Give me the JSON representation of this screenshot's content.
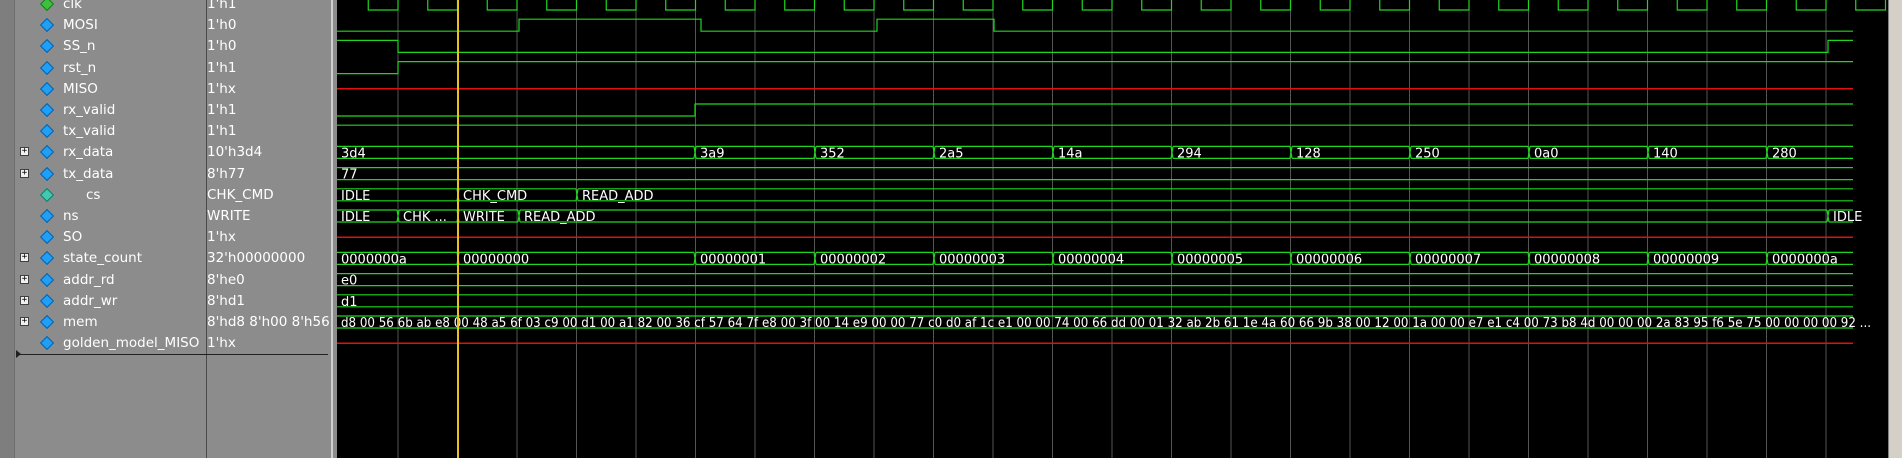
{
  "signals": [
    {
      "name": "clk",
      "value": "1'h1",
      "expand": false,
      "icon": "clock-signal-icon"
    },
    {
      "name": "MOSI",
      "value": "1'h0",
      "expand": false,
      "icon": "signal-icon"
    },
    {
      "name": "SS_n",
      "value": "1'h0",
      "expand": false,
      "icon": "signal-icon"
    },
    {
      "name": "rst_n",
      "value": "1'h1",
      "expand": false,
      "icon": "signal-icon"
    },
    {
      "name": "MISO",
      "value": "1'hx",
      "expand": false,
      "icon": "signal-icon"
    },
    {
      "name": "rx_valid",
      "value": "1'h1",
      "expand": false,
      "icon": "signal-icon"
    },
    {
      "name": "tx_valid",
      "value": "1'h1",
      "expand": false,
      "icon": "signal-icon"
    },
    {
      "name": "rx_data",
      "value": "10'h3d4",
      "expand": true,
      "icon": "signal-icon"
    },
    {
      "name": "tx_data",
      "value": "8'h77",
      "expand": true,
      "icon": "signal-icon"
    },
    {
      "name": "cs",
      "value": "CHK_CMD",
      "expand": false,
      "icon": "state-machine-icon"
    },
    {
      "name": "ns",
      "value": "WRITE",
      "expand": false,
      "icon": "signal-icon"
    },
    {
      "name": "SO",
      "value": "1'hx",
      "expand": false,
      "icon": "signal-icon"
    },
    {
      "name": "state_count",
      "value": "32'h00000000",
      "expand": true,
      "icon": "signal-icon"
    },
    {
      "name": "addr_rd",
      "value": "8'he0",
      "expand": true,
      "icon": "signal-icon"
    },
    {
      "name": "addr_wr",
      "value": "8'hd1",
      "expand": true,
      "icon": "signal-icon"
    },
    {
      "name": "mem",
      "value": "8'hd8 8'h00 8'h56 ...",
      "expand": true,
      "icon": "signal-icon"
    },
    {
      "name": "golden_model_MISO",
      "value": "1'hx",
      "expand": false,
      "icon": "signal-icon"
    }
  ],
  "waves": {
    "rx_data": [
      "3d4",
      "3a9",
      "352",
      "2a5",
      "14a",
      "294",
      "128",
      "250",
      "0a0",
      "140",
      "280"
    ],
    "tx_data": [
      "77"
    ],
    "cs": [
      "IDLE",
      "CHK_CMD",
      "READ_ADD"
    ],
    "ns": [
      "IDLE",
      "CHK ...",
      "WRITE",
      "READ_ADD",
      "IDLE"
    ],
    "state_count": [
      "0000000a",
      "00000000",
      "00000001",
      "00000002",
      "00000003",
      "00000004",
      "00000005",
      "00000006",
      "00000007",
      "00000008",
      "00000009",
      "0000000a"
    ],
    "addr_rd": [
      "e0"
    ],
    "addr_wr": [
      "d1"
    ],
    "mem": "d8 00 56 6b ab e8 00 48 a5 6f 03 c9 00 d1 00 a1 82 00 36 cf 57 64 7f e8 00 3f 00 14 e9 00 00 77 c0 d0 af 1c e1 00 00 74 00 66 dd 00 01 32 ab 2b 61 1e 4a 60 66 9b 38 00 12 00 1a 00 00 e7 e1 c4 00 73 b8 4d 00 00 00 2a 83 95 f6 5e 75 00 00 00 00 92 ..."
  },
  "colors": {
    "wave": "#1fd51f",
    "unknown": "#e01010",
    "cursor": "#e8c020",
    "grid": "#5a5a5a",
    "panel": "#8c8c8c"
  }
}
